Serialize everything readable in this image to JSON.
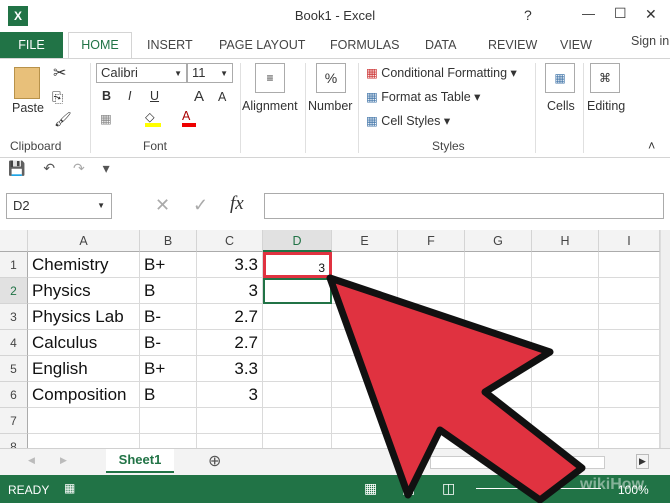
{
  "window": {
    "title": "Book1 - Excel",
    "help": "?",
    "minimize": "—",
    "maximize": "☐",
    "close": "✕",
    "app_icon": "X"
  },
  "tabs": [
    "FILE",
    "HOME",
    "INSERT",
    "PAGE LAYOUT",
    "FORMULAS",
    "DATA",
    "REVIEW",
    "VIEW"
  ],
  "sign_in": "Sign in",
  "ribbon": {
    "clipboard": {
      "paste": "Paste",
      "group": "Clipboard"
    },
    "font": {
      "name": "Calibri",
      "size": "11",
      "bold": "B",
      "italic": "I",
      "underline": "U",
      "grow": "A",
      "shrink": "A",
      "color": "A",
      "group": "Font"
    },
    "alignment": "Alignment",
    "number": "Number",
    "percent": "%",
    "styles": {
      "conditional": "Conditional Formatting",
      "table": "Format as Table",
      "cell_styles": "Cell Styles",
      "group": "Styles"
    },
    "cells": "Cells",
    "editing": "Editing"
  },
  "formula_bar": {
    "name_box": "D2",
    "fx": "fx",
    "cancel": "✕",
    "enter": "✓",
    "value": ""
  },
  "columns": [
    "A",
    "B",
    "C",
    "D",
    "E",
    "F",
    "G",
    "H",
    "I"
  ],
  "rows": [
    {
      "n": "1",
      "a": "Chemistry",
      "b": "B+",
      "c": "3.3",
      "d": "3"
    },
    {
      "n": "2",
      "a": "Physics",
      "b": "B",
      "c": "3",
      "d": ""
    },
    {
      "n": "3",
      "a": "Physics Lab",
      "b": "B-",
      "c": "2.7",
      "d": ""
    },
    {
      "n": "4",
      "a": "Calculus",
      "b": "B-",
      "c": "2.7",
      "d": ""
    },
    {
      "n": "5",
      "a": "English",
      "b": "B+",
      "c": "3.3",
      "d": ""
    },
    {
      "n": "6",
      "a": "Composition",
      "b": "B",
      "c": "3",
      "d": ""
    },
    {
      "n": "7",
      "a": "",
      "b": "",
      "c": "",
      "d": ""
    },
    {
      "n": "8",
      "a": "",
      "b": "",
      "c": "",
      "d": ""
    }
  ],
  "sheet_tab": "Sheet1",
  "status": {
    "ready": "READY",
    "zoom": "100%"
  },
  "watermark": "wikiHow",
  "colors": {
    "excel_green": "#217346",
    "arrow_red": "#e03240",
    "selection": "#e03240"
  }
}
